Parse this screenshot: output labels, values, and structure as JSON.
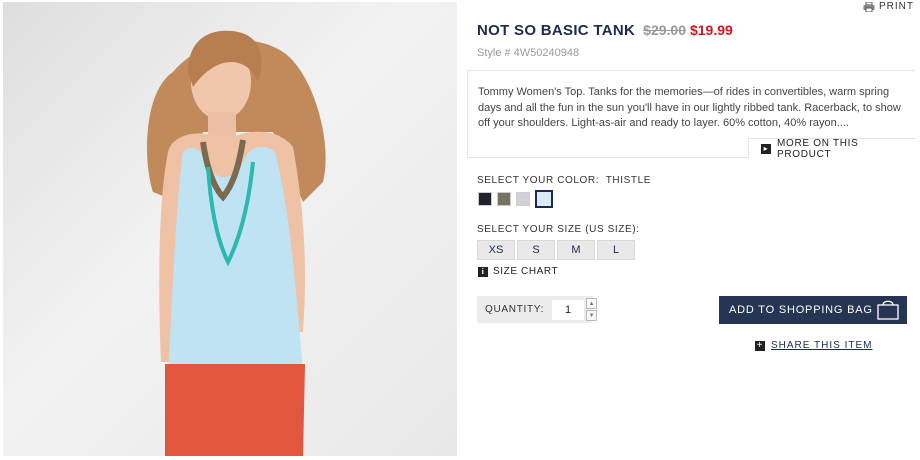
{
  "print_label": "PRINT",
  "product": {
    "title": "NOT SO BASIC TANK",
    "old_price": "$29.00",
    "new_price": "$19.99",
    "style_number": "Style # 4W50240948",
    "description": "Tommy Women's Top. Tanks for the memories—of rides in convertibles, warm spring days and all the fun in the sun you'll have in our lightly ribbed tank. Racerback, to show off your shoulders. Light-as-air and ready to layer. 60% cotton, 40% rayon....",
    "more_link": "MORE ON THIS PRODUCT"
  },
  "color": {
    "label": "SELECT YOUR COLOR:",
    "selected": "THISTLE",
    "swatches": [
      {
        "name": "black",
        "hex": "#1f232b"
      },
      {
        "name": "olive",
        "hex": "#77735f"
      },
      {
        "name": "lavender",
        "hex": "#d3d0dc"
      },
      {
        "name": "thistle",
        "hex": "#dcecf7"
      }
    ]
  },
  "size": {
    "label": "SELECT YOUR SIZE (US SIZE):",
    "options": [
      "XS",
      "S",
      "M",
      "L"
    ],
    "chart_link": "SIZE CHART"
  },
  "quantity": {
    "label": "QUANTITY:",
    "value": "1"
  },
  "add_to_bag": "ADD TO SHOPPING BAG",
  "share": "SHARE THIS ITEM",
  "colors": {
    "navy": "#1b2a4e",
    "sale_red": "#d2151d",
    "button_bg": "#253553"
  }
}
